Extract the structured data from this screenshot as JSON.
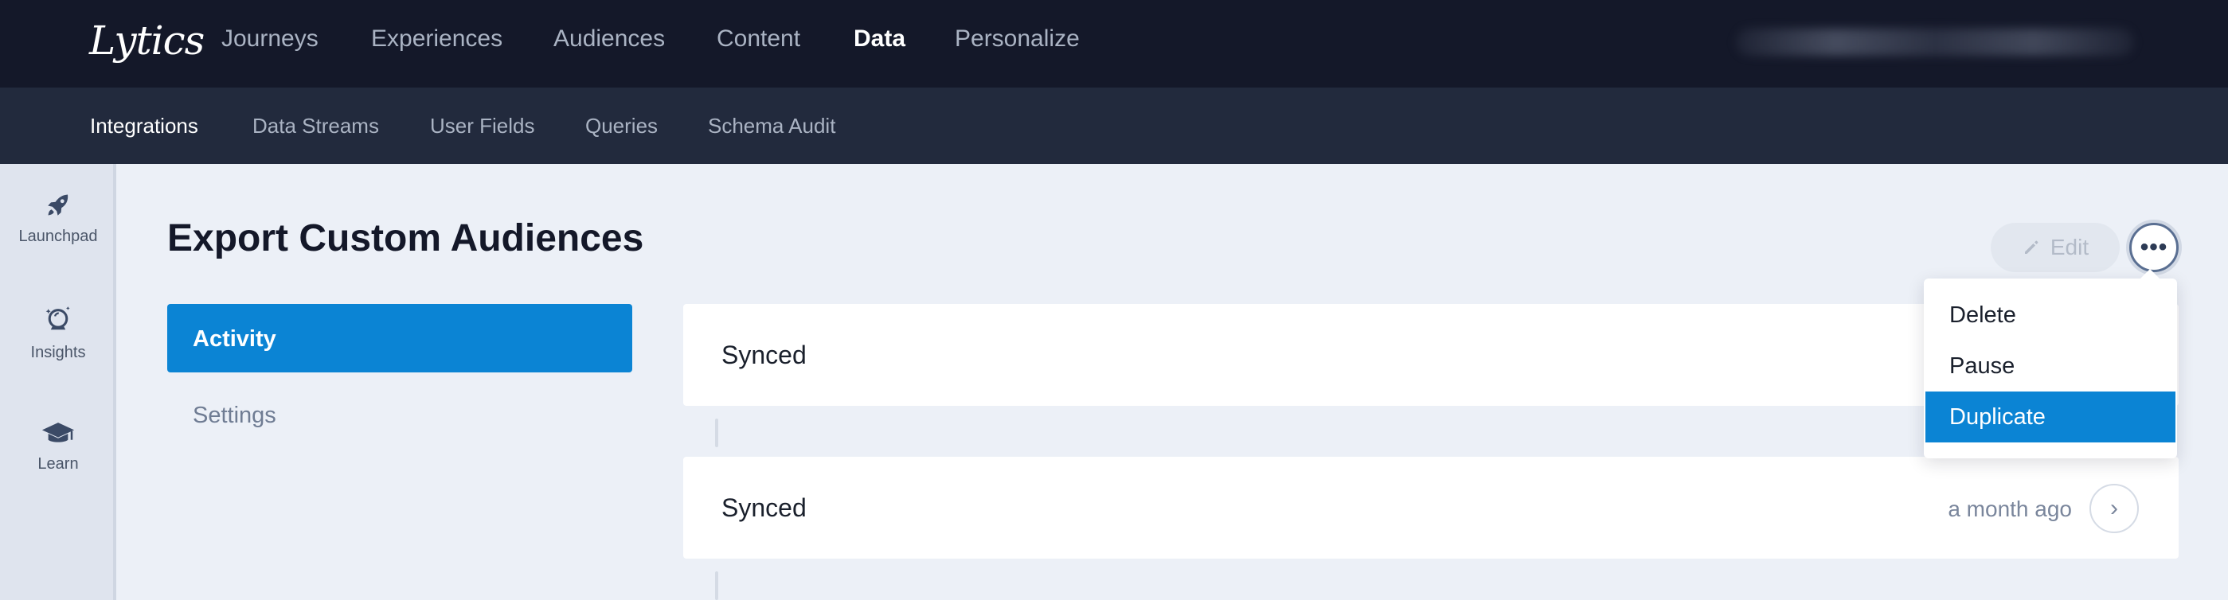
{
  "brand": {
    "logo_text": "Lytics"
  },
  "top_nav": {
    "items": [
      {
        "label": "Journeys"
      },
      {
        "label": "Experiences"
      },
      {
        "label": "Audiences"
      },
      {
        "label": "Content"
      },
      {
        "label": "Data",
        "active": true
      },
      {
        "label": "Personalize"
      }
    ]
  },
  "sub_nav": {
    "items": [
      {
        "label": "Integrations",
        "active": true
      },
      {
        "label": "Data Streams"
      },
      {
        "label": "User Fields"
      },
      {
        "label": "Queries"
      },
      {
        "label": "Schema Audit"
      }
    ]
  },
  "rail": {
    "items": [
      {
        "label": "Launchpad",
        "icon": "rocket-icon"
      },
      {
        "label": "Insights",
        "icon": "crystal-ball-icon"
      },
      {
        "label": "Learn",
        "icon": "graduation-cap-icon"
      }
    ]
  },
  "page": {
    "title": "Export Custom Audiences",
    "edit_label": "Edit",
    "more_icon": "ellipsis-icon"
  },
  "side_tabs": {
    "activity": "Activity",
    "settings": "Settings"
  },
  "activity": {
    "items": [
      {
        "title": "Synced",
        "time": ""
      },
      {
        "title": "Synced",
        "time": "a month ago"
      }
    ]
  },
  "menu": {
    "items": [
      {
        "label": "Delete"
      },
      {
        "label": "Pause"
      },
      {
        "label": "Duplicate",
        "highlighted": true
      }
    ]
  },
  "colors": {
    "top_nav_bg": "#141829",
    "sub_nav_bg": "#222a3d",
    "accent": "#0b84d4",
    "page_bg": "#ecf0f7"
  }
}
